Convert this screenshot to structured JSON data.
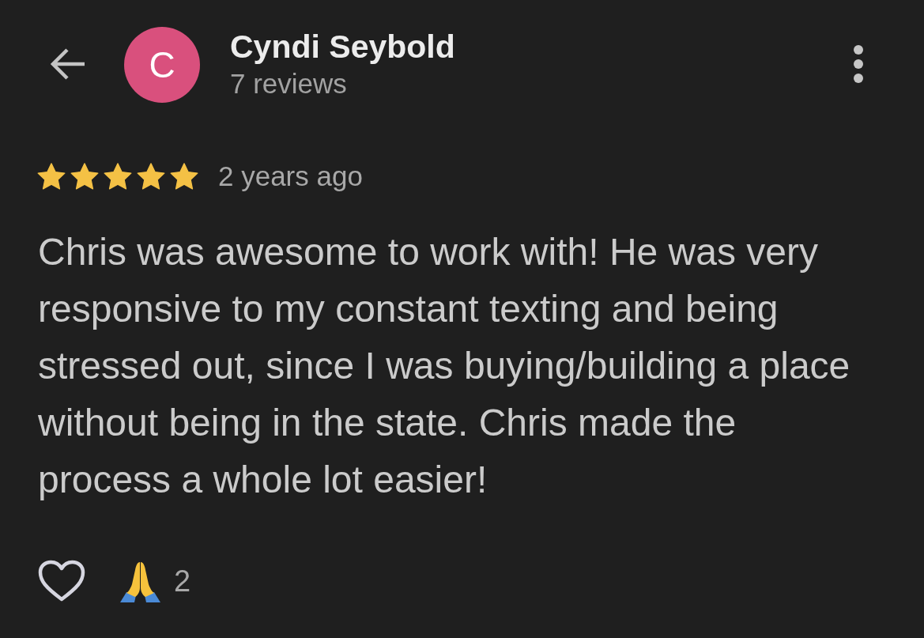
{
  "header": {
    "initial": "C",
    "name": "Cyndi Seybold",
    "reviews": "7 reviews"
  },
  "review": {
    "stars": 5,
    "time": "2 years ago",
    "text": "Chris was awesome to work with! He was very responsive to my constant texting and being stressed out, since I was buying/building a place without being in the state. Chris made the process a whole lot easier!"
  },
  "reactions": {
    "liked": false,
    "count": "2"
  }
}
